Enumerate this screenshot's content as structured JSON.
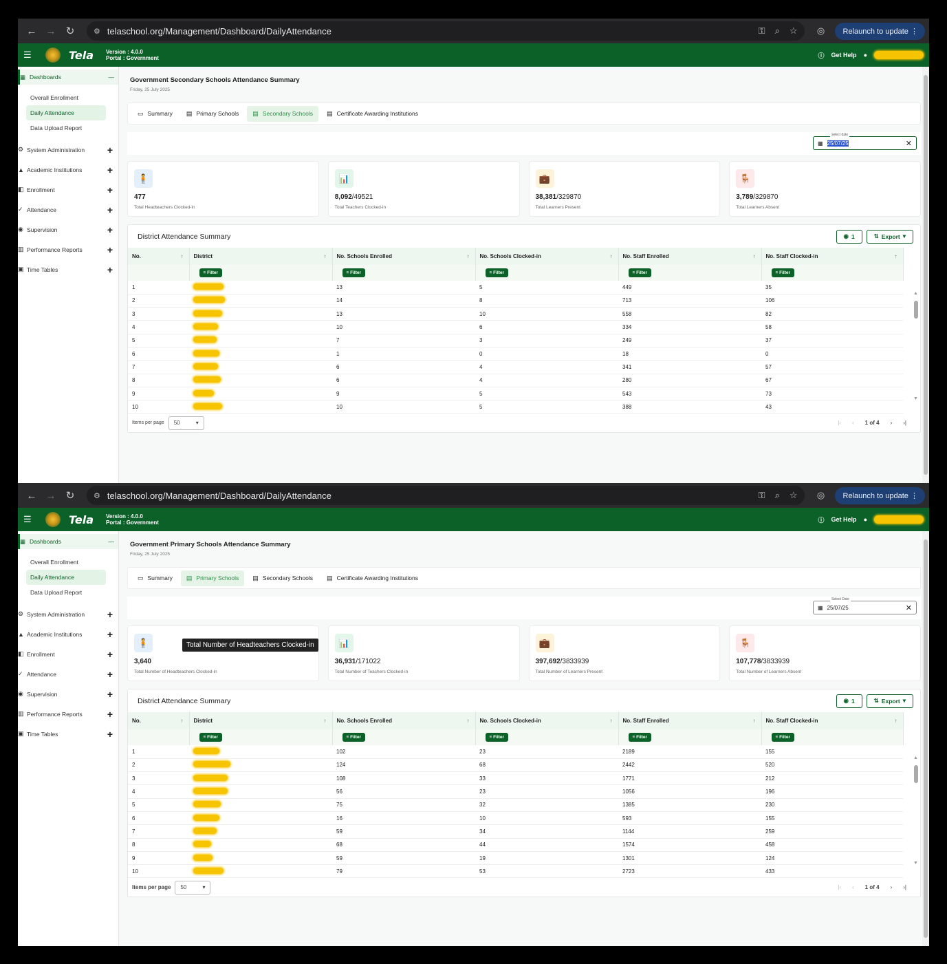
{
  "browser": {
    "url": "telaschool.org/Management/Dashboard/DailyAttendance",
    "relaunch": "Relaunch to update"
  },
  "app": {
    "logo": "Tela",
    "version": "Version : 4.0.0",
    "portal": "Portal : Government",
    "help": "Get Help"
  },
  "sidebar": {
    "dashboards": "Dashboards",
    "subs": [
      "Overall Enrollment",
      "Daily Attendance",
      "Data Upload Report"
    ],
    "groups": [
      "System Administration",
      "Academic Institutions",
      "Enrollment",
      "Attendance",
      "Supervision",
      "Performance Reports",
      "Time Tables"
    ]
  },
  "tabs": [
    "Summary",
    "Primary Schools",
    "Secondary Schools",
    "Certificate Awarding Institutions"
  ],
  "table": {
    "title": "District Attendance Summary",
    "columns": [
      "No.",
      "District",
      "No. Schools Enrolled",
      "No. Schools Clocked-in",
      "No. Staff Enrolled",
      "No. Staff Clocked-in"
    ],
    "filter": "Filter",
    "views": "1",
    "export": "Export",
    "items_label": "Items per page",
    "page": "1 of 4"
  },
  "views": [
    {
      "title": "Government Secondary Schools Attendance Summary",
      "date": "Friday, 25 July 2025",
      "active_tab": 2,
      "date_label": "select date",
      "date_value": "25/07/25",
      "page_size": "50",
      "cards": [
        {
          "value": "477",
          "total": "",
          "label": "Total Headteachers Clocked-in"
        },
        {
          "value": "8,092",
          "total": "/49521",
          "label": "Total Teachers Clocked-in"
        },
        {
          "value": "38,381",
          "total": "/329870",
          "label": "Total Learners Present"
        },
        {
          "value": "3,789",
          "total": "/329870",
          "label": "Total Learners Absent"
        }
      ],
      "rows": [
        [
          "1",
          "13",
          "5",
          "449",
          "35"
        ],
        [
          "2",
          "14",
          "8",
          "713",
          "106"
        ],
        [
          "3",
          "13",
          "10",
          "558",
          "82"
        ],
        [
          "4",
          "10",
          "6",
          "334",
          "58"
        ],
        [
          "5",
          "7",
          "3",
          "249",
          "37"
        ],
        [
          "6",
          "1",
          "0",
          "18",
          "0"
        ],
        [
          "7",
          "6",
          "4",
          "341",
          "57"
        ],
        [
          "8",
          "6",
          "4",
          "280",
          "67"
        ],
        [
          "9",
          "9",
          "5",
          "543",
          "73"
        ],
        [
          "10",
          "10",
          "5",
          "388",
          "43"
        ]
      ]
    },
    {
      "title": "Government Primary Schools Attendance Summary",
      "date": "Friday, 25 July 2025",
      "active_tab": 1,
      "date_label": "Select Date",
      "date_value": "25/07/25",
      "page_size": "50",
      "tooltip": "Total Number of Headteachers Clocked-in",
      "cards": [
        {
          "value": "3,640",
          "total": "",
          "label": "Total Number of Headteachers Clocked-in"
        },
        {
          "value": "36,931",
          "total": "/171022",
          "label": "Total Number of Teachers Clocked-in"
        },
        {
          "value": "397,692",
          "total": "/3833939",
          "label": "Total Number of Learners Present"
        },
        {
          "value": "107,778",
          "total": "/3833939",
          "label": "Total Number of Learners Absent"
        }
      ],
      "rows": [
        [
          "1",
          "102",
          "23",
          "2189",
          "155"
        ],
        [
          "2",
          "124",
          "68",
          "2442",
          "520"
        ],
        [
          "3",
          "108",
          "33",
          "1771",
          "212"
        ],
        [
          "4",
          "56",
          "23",
          "1056",
          "196"
        ],
        [
          "5",
          "75",
          "32",
          "1385",
          "230"
        ],
        [
          "6",
          "16",
          "10",
          "593",
          "155"
        ],
        [
          "7",
          "59",
          "34",
          "1144",
          "259"
        ],
        [
          "8",
          "68",
          "44",
          "1574",
          "458"
        ],
        [
          "9",
          "59",
          "19",
          "1301",
          "124"
        ],
        [
          "10",
          "79",
          "53",
          "2723",
          "433"
        ]
      ]
    }
  ]
}
